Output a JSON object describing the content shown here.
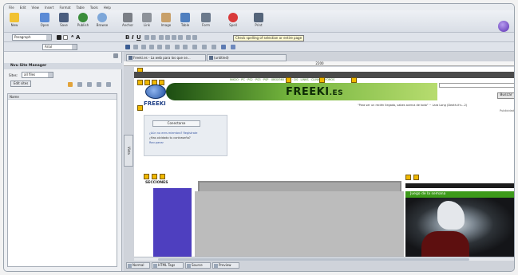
{
  "menu": [
    "File",
    "Edit",
    "View",
    "Insert",
    "Format",
    "Table",
    "Tools",
    "Help"
  ],
  "toolbar": {
    "buttons": [
      "New",
      "Open",
      "Save",
      "Publish",
      "Browse",
      "Anchor",
      "Link",
      "Image",
      "Table",
      "Form",
      "Spell",
      "Print"
    ]
  },
  "format_bar": {
    "paragraph_value": "Paragraph",
    "font_value": "Arial",
    "tooltip": "Check spelling of selection or entire page"
  },
  "site_manager": {
    "title": "Nvu Site Manager",
    "sites_label": "Sites:",
    "sites_value": "all files",
    "edit_sites_button": "Edit sites",
    "name_column": "Name"
  },
  "editor": {
    "tabs": [
      "Freeki.es - La web para los que se...",
      "(untitled)"
    ],
    "ruler_label": "2200",
    "side_strip": "Vista",
    "bottom_tabs": [
      "Normal",
      "HTML Tags",
      "Source",
      "Preview"
    ]
  },
  "page": {
    "nav_links": "INICIO · PC · PS2 · PS3 · PSP · XBOX360 · WII · DS · LINKS · CLINICA · FOROS",
    "banner_title": "FREEKI",
    "banner_suffix": ".ES",
    "logo_text": "FREEKI",
    "search_button": "Buscar",
    "quote": "\"Para ser un recién llegado, sabes acerca de todo\" ~ Lara Long (Death-it's...2)",
    "login_button": "Conectarse",
    "register_link": "¿Aún no eres miembro? Regístrate",
    "forgot_link": "¿Has olvidado tu contraseña?",
    "recover_link": "Recuperar",
    "publicity": "Publicidad",
    "sections_heading": "SECCIONES",
    "game_of_week": "Juego de la semana"
  },
  "colors": {
    "banner_dark": "#1c4d12",
    "banner_light": "#b7dc6f",
    "purple_column": "#4e3fbf",
    "game_title_bg": "#3d9a1a",
    "tag_marker": "#f0b800"
  }
}
